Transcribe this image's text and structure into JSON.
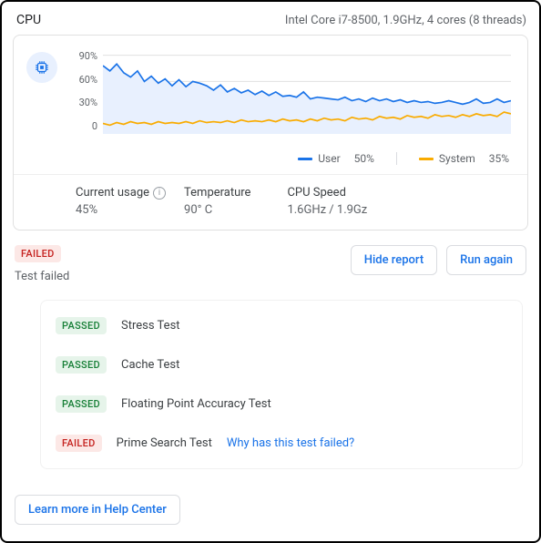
{
  "header": {
    "title": "CPU",
    "spec": "Intel Core i7-8500, 1.9GHz, 4 cores (8 threads)"
  },
  "chart_data": {
    "type": "line",
    "ylim": [
      0,
      100
    ],
    "y_ticks": [
      "90%",
      "60%",
      "30%",
      "0"
    ],
    "fill_series_index": 0,
    "colors": {
      "user": "#1a73e8",
      "system": "#f9ab00",
      "grid": "#e0e0e0",
      "fill": "#e8f0fe"
    },
    "series": [
      {
        "name": "User",
        "current_label": "50%",
        "values": [
          78,
          72,
          80,
          70,
          65,
          72,
          60,
          66,
          58,
          63,
          55,
          62,
          54,
          60,
          58,
          55,
          50,
          56,
          48,
          52,
          47,
          50,
          45,
          49,
          44,
          48,
          43,
          44,
          42,
          48,
          40,
          42,
          41,
          40,
          39,
          42,
          38,
          40,
          37,
          41,
          38,
          40,
          37,
          39,
          36,
          38,
          36,
          37,
          35,
          36,
          38,
          36,
          34,
          36,
          40,
          35,
          36,
          40,
          36,
          38
        ]
      },
      {
        "name": "System",
        "current_label": "35%",
        "values": [
          12,
          10,
          13,
          11,
          14,
          12,
          13,
          11,
          14,
          12,
          13,
          12,
          14,
          12,
          15,
          13,
          14,
          13,
          15,
          13,
          16,
          14,
          15,
          14,
          16,
          14,
          17,
          15,
          16,
          14,
          17,
          15,
          18,
          16,
          17,
          15,
          19,
          17,
          18,
          16,
          20,
          18,
          19,
          17,
          21,
          19,
          20,
          18,
          22,
          20,
          21,
          19,
          22,
          20,
          23,
          21,
          22,
          20,
          25,
          23
        ]
      }
    ]
  },
  "metrics": {
    "usage": {
      "label": "Current usage",
      "value": "45%"
    },
    "temperature": {
      "label": "Temperature",
      "value": "90° C"
    },
    "speed": {
      "label": "CPU Speed",
      "value": "1.6GHz / 1.9Gz"
    }
  },
  "tests": {
    "overall_badge": "FAILED",
    "overall_text": "Test failed",
    "actions": {
      "hide": "Hide report",
      "run": "Run again"
    },
    "fail_link_text": "Why has this test failed?",
    "items": [
      {
        "status": "PASSED",
        "name": "Stress Test"
      },
      {
        "status": "PASSED",
        "name": "Cache Test"
      },
      {
        "status": "PASSED",
        "name": "Floating Point Accuracy Test"
      },
      {
        "status": "FAILED",
        "name": "Prime Search Test",
        "has_link": true
      }
    ]
  },
  "footer": {
    "help": "Learn more in Help Center"
  }
}
